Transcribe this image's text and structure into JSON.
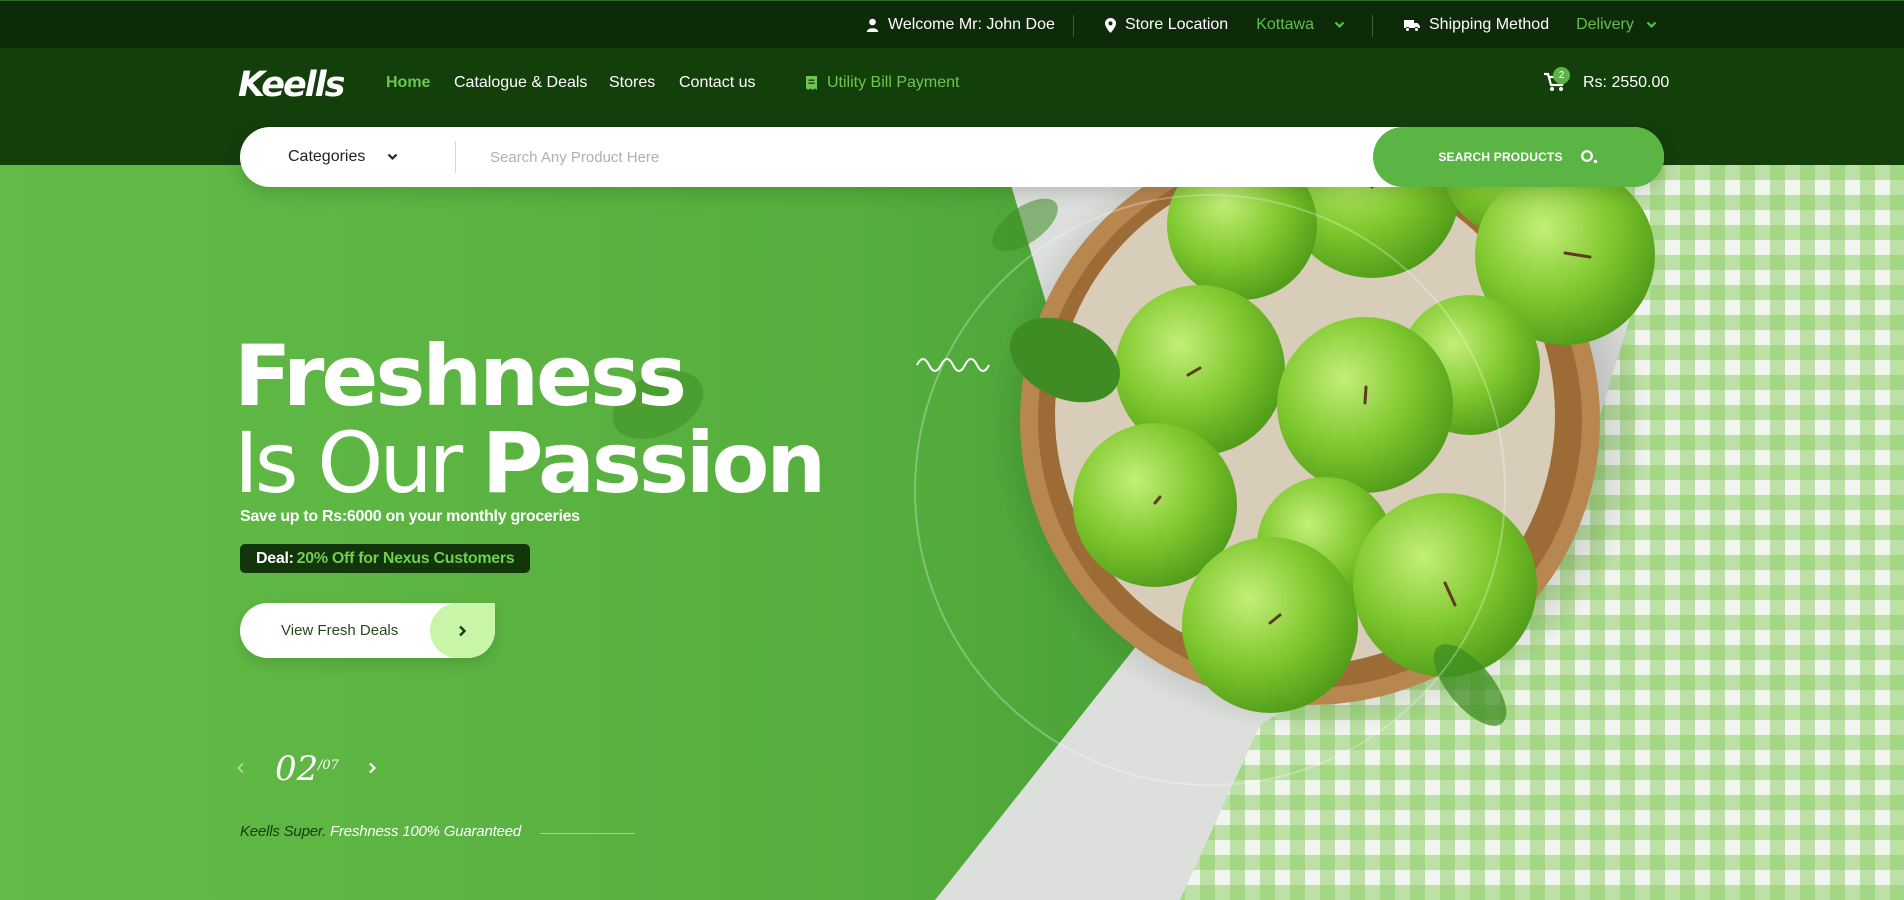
{
  "topbar": {
    "welcome": "Welcome Mr: John Doe",
    "store_location_label": "Store Location",
    "store_location_value": "Kottawa",
    "shipping_label": "Shipping Method",
    "shipping_value": "Delivery"
  },
  "nav": {
    "logo": "Keells",
    "links": [
      "Home",
      "Catalogue & Deals",
      "Stores",
      "Contact us"
    ],
    "utility": "Utility Bill Payment",
    "cart_count": "2",
    "cart_total": "Rs: 2550.00"
  },
  "search": {
    "category_label": "Categories",
    "placeholder": "Search Any Product Here",
    "button_label": "SEARCH PRODUCTS"
  },
  "hero": {
    "line1": "Freshness",
    "line2_light": "Is Our",
    "line2_bold": "Passion",
    "subtitle": "Save up to Rs:6000 on your monthly groceries",
    "deal_label": "Deal:",
    "deal_text": "20% Off for Nexus Customers",
    "cta": "View Fresh Deals",
    "slide_current": "02",
    "slide_total": "/07",
    "tagline_brand": "Keells Super.",
    "tagline_text": "Freshness 100% Guaranteed"
  },
  "colors": {
    "topbar_bg": "#0d2a09",
    "nav_bg": "#133f0b",
    "accent_green": "#5bb544",
    "link_green": "#6fc552",
    "deal_bg": "#12350b",
    "cta_arrow_bg": "#c9f5a9"
  },
  "icons": {
    "user": "user-icon",
    "location": "map-pin-icon",
    "truck": "truck-icon",
    "bill": "receipt-icon",
    "cart": "cart-icon",
    "search": "search-icon"
  }
}
